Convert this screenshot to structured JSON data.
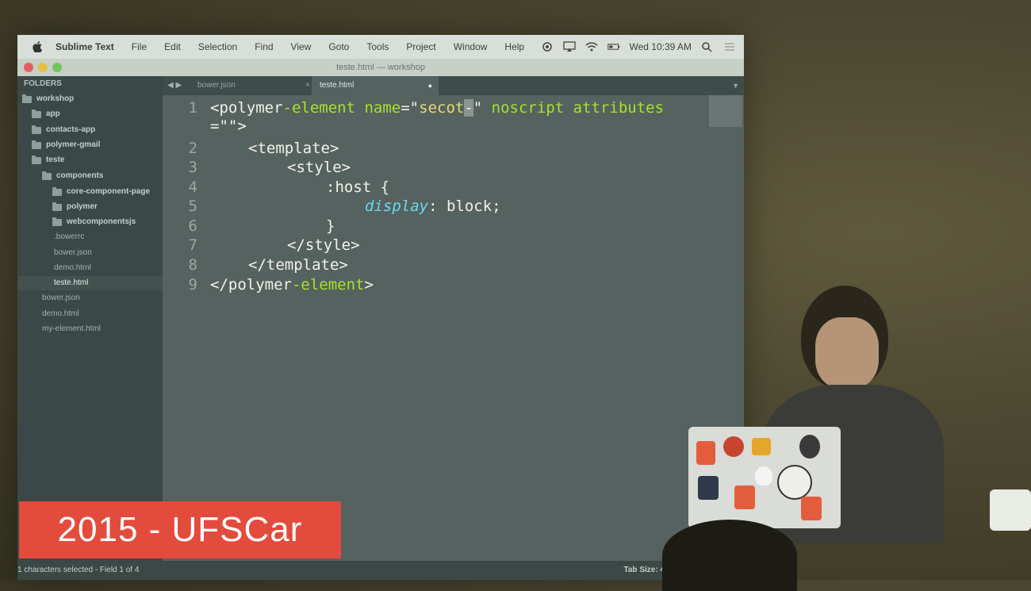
{
  "menubar": {
    "app_name": "Sublime Text",
    "items": [
      "File",
      "Edit",
      "Selection",
      "Find",
      "View",
      "Goto",
      "Tools",
      "Project",
      "Window",
      "Help"
    ],
    "clock": "Wed 10:39 AM"
  },
  "window": {
    "title": "teste.html — workshop"
  },
  "sidebar": {
    "title": "FOLDERS",
    "tree": [
      {
        "label": "workshop",
        "type": "folder"
      },
      {
        "label": "app",
        "type": "folder"
      },
      {
        "label": "contacts-app",
        "type": "folder"
      },
      {
        "label": "polymer-gmail",
        "type": "folder"
      },
      {
        "label": "teste",
        "type": "folder"
      },
      {
        "label": "components",
        "type": "folder"
      },
      {
        "label": "core-component-page",
        "type": "folder"
      },
      {
        "label": "polymer",
        "type": "folder"
      },
      {
        "label": "webcomponentsjs",
        "type": "folder"
      },
      {
        "label": ".bowerrc",
        "type": "file"
      },
      {
        "label": "bower.json",
        "type": "file"
      },
      {
        "label": "demo.html",
        "type": "file"
      },
      {
        "label": "teste.html",
        "type": "file",
        "active": true
      },
      {
        "label": "bower.json",
        "type": "file"
      },
      {
        "label": "demo.html",
        "type": "file"
      },
      {
        "label": "my-element.html",
        "type": "file"
      }
    ]
  },
  "tabs": [
    {
      "label": "bower.json",
      "close": "×"
    },
    {
      "label": "teste.html",
      "active": true,
      "dirty": "●"
    }
  ],
  "editor": {
    "line_numbers": [
      "1",
      "2",
      "3",
      "4",
      "5",
      "6",
      "7",
      "8",
      "9"
    ],
    "lines": {
      "l1a": "<polymer",
      "l1b": "-element",
      "l1c": " name",
      "l1d": "=\"",
      "l1e": "secot",
      "l1f": "-",
      "l1g": "\"",
      "l1h": " noscript",
      "l1i": " attributes",
      "l1j": "=\"\">",
      "l2": "<template>",
      "l3": "<style>",
      "l4": ":host {",
      "l5a": "display",
      "l5b": ": block;",
      "l6": "}",
      "l7": "</style>",
      "l8": "</template>",
      "l9a": "</polymer",
      "l9b": "-element",
      "l9c": ">"
    }
  },
  "statusbar": {
    "left": "1 characters selected - Field 1 of 4",
    "right": "Tab Size: 4"
  },
  "banner": {
    "text": "2015 - UFSCar"
  }
}
